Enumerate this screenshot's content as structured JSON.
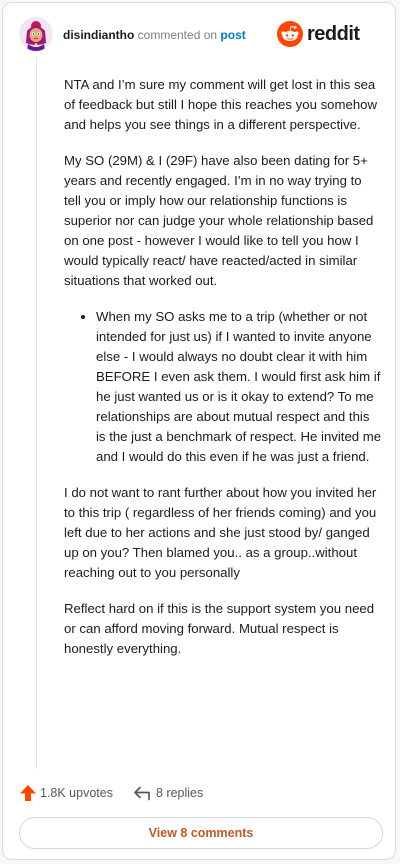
{
  "header": {
    "username": "disindiantho",
    "action_text": "commented on",
    "post_link": "post"
  },
  "brand": {
    "wordmark": "reddit",
    "icon": "reddit-alien-icon",
    "color": "#ff4500"
  },
  "comment": {
    "paragraphs_before": [
      "NTA and I’m sure my comment will get lost in this sea of feedback but still I hope this reaches you somehow and helps you see things in a different perspective.",
      "My SO (29M) & I (29F) have also been dating for 5+ years and recently engaged. I’m in no way trying to tell you or imply how our relationship functions is superior nor can judge your whole relationship based on one post - however I would like to tell you how I would typically react/ have reacted/acted in similar situations that worked out."
    ],
    "bullets": [
      "When my SO asks me to a trip (whether or not intended for just us) if I wanted to invite anyone else - I would always no doubt clear it with him BEFORE I even ask them. I would first ask him if he just wanted us or is it okay to extend? To me relationships are about mutual respect and this is the just a benchmark of respect. He invited me and I would do this even if he was just a friend."
    ],
    "paragraphs_after": [
      "I do not want to rant further about how you invited her to this trip ( regardless of her friends coming) and you left due to her actions and she just stood by/ ganged up on you? Then blamed you.. as a group..without reaching out to you personally",
      "Reflect hard on if this is the support system you need or can afford moving forward. Mutual respect is honestly everything."
    ]
  },
  "actions": {
    "upvotes": "1.8K upvotes",
    "replies": "8 replies",
    "upvote_color": "#ff4500"
  },
  "view_button": {
    "label": "View 8 comments",
    "color": "#c15a24"
  }
}
